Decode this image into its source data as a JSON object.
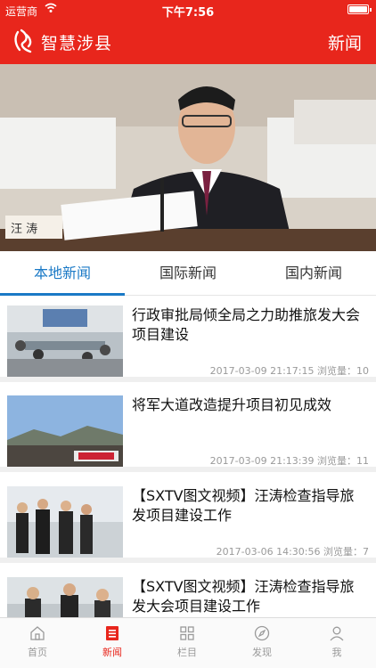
{
  "status_bar": {
    "carrier": "运营商",
    "time": "下午7:56",
    "battery_level": 1.0
  },
  "header": {
    "app_title": "智慧涉县",
    "section_title": "新闻"
  },
  "hero": {
    "caption": "汪 涛"
  },
  "tabs": [
    {
      "label": "本地新闻",
      "active": true
    },
    {
      "label": "国际新闻",
      "active": false
    },
    {
      "label": "国内新闻",
      "active": false
    }
  ],
  "news": [
    {
      "title": "行政审批局倾全局之力助推旅发大会项目建设",
      "date": "2017-03-09 21:17:15",
      "views_label": "浏览量：",
      "views": "10",
      "thumb_caption": ""
    },
    {
      "title": "将军大道改造提升项目初见成效",
      "date": "2017-03-09 21:13:39",
      "views_label": "浏览量：",
      "views": "11",
      "thumb_caption": ""
    },
    {
      "title": "【SXTV图文视频】汪涛检查指导旅发项目建设工作",
      "date": "2017-03-06 14:30:56",
      "views_label": "浏览量：",
      "views": "7",
      "thumb_caption": ""
    },
    {
      "title": "【SXTV图文视频】汪涛检查指导旅发大会项目建设工作",
      "date": "",
      "views_label": "",
      "views": "",
      "thumb_caption": ""
    }
  ],
  "tabbar": [
    {
      "label": "首页",
      "icon": "home-icon",
      "active": false
    },
    {
      "label": "新闻",
      "icon": "news-icon",
      "active": true
    },
    {
      "label": "栏目",
      "icon": "grid-icon",
      "active": false
    },
    {
      "label": "发现",
      "icon": "compass-icon",
      "active": false
    },
    {
      "label": "我",
      "icon": "user-icon",
      "active": false
    }
  ],
  "colors": {
    "brand": "#e8261c",
    "tab_active": "#1a79c6",
    "meta_text": "#9a9a9a"
  }
}
